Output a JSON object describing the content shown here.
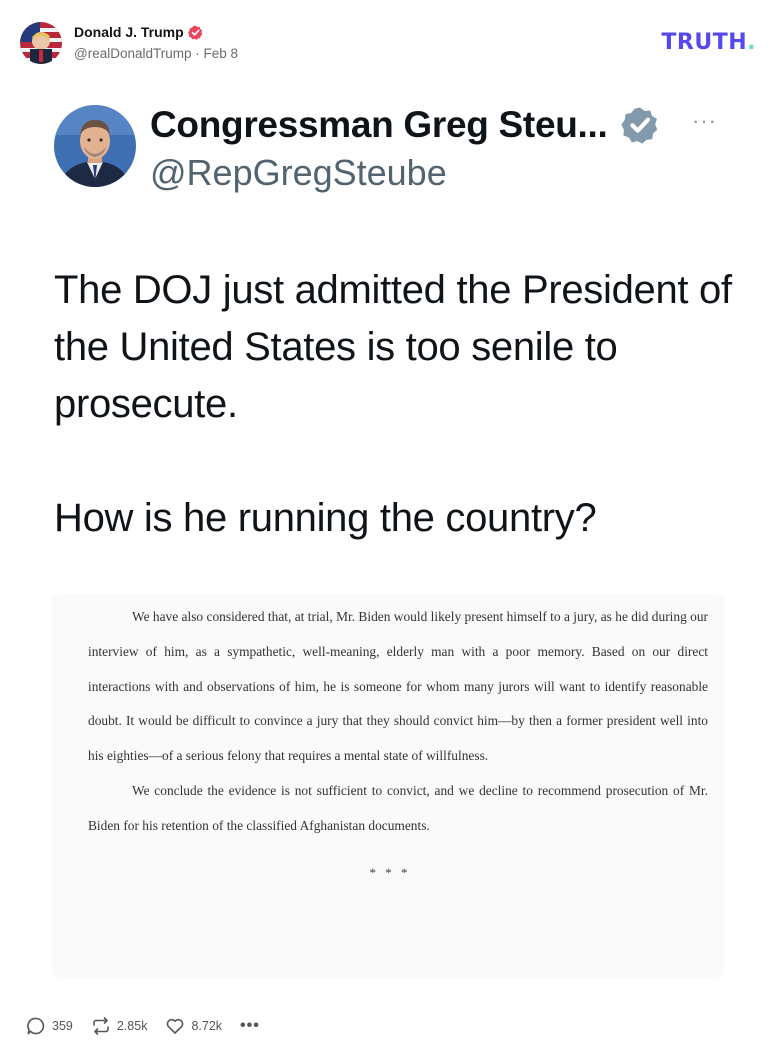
{
  "post": {
    "author_name": "Donald J. Trump",
    "author_handle": "@realDonaldTrump",
    "separator": "·",
    "date": "Feb 8",
    "brand": "TRUTH",
    "brand_dot": ".",
    "avatar_icon": "flag-portrait-avatar",
    "verified_icon": "verified-badge-icon"
  },
  "embed": {
    "name": "Congressman Greg Steu...",
    "handle": "@RepGregSteube",
    "more": "···",
    "verified_icon": "verified-badge-icon",
    "paragraphs": [
      "The DOJ just admitted the President of the United States is too senile to prosecute.",
      "How is he running the country?"
    ]
  },
  "document": {
    "paragraphs": [
      "We have also considered that, at trial, Mr. Biden would likely present himself to a jury, as he did during our interview of him, as a sympathetic, well-meaning, elderly man with a poor memory. Based on our direct interactions with and observations of him, he is someone for whom many jurors will want to identify reasonable doubt. It would be difficult to convince a jury that they should convict him—by then a former president well into his eighties—of a serious felony that requires a mental state of willfulness.",
      "We conclude the evidence is not sufficient to convict, and we decline to recommend prosecution of Mr. Biden for his retention of the classified Afghanistan documents."
    ],
    "stars": "* * *"
  },
  "actions": {
    "replies": "359",
    "reposts": "2.85k",
    "likes": "8.72k",
    "more": "•••"
  },
  "colors": {
    "brand": "#5448ee",
    "brand_dot": "#5ee0c6",
    "badge_red": "#e8465f",
    "badge_gray": "#829aab"
  }
}
